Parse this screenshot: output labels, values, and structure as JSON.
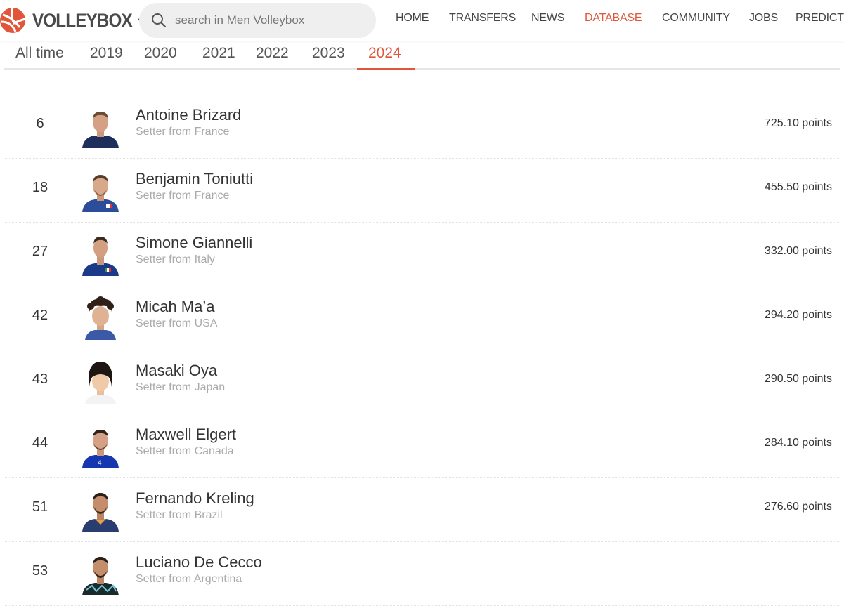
{
  "header": {
    "logo_text": "VOLLEYBOX",
    "search_placeholder": "search in Men Volleybox",
    "nav": [
      {
        "label": "HOME"
      },
      {
        "label": "TRANSFERS"
      },
      {
        "label": "NEWS"
      },
      {
        "label": "DATABASE",
        "active": true
      },
      {
        "label": "COMMUNITY"
      },
      {
        "label": "JOBS"
      },
      {
        "label": "PREDICTIC"
      }
    ]
  },
  "tabs": [
    {
      "label": "All time"
    },
    {
      "label": "2019"
    },
    {
      "label": "2020"
    },
    {
      "label": "2021"
    },
    {
      "label": "2022"
    },
    {
      "label": "2023"
    },
    {
      "label": "2024",
      "active": true
    }
  ],
  "players": [
    {
      "rank": "6",
      "name": "Antoine Brizard",
      "desc": "Setter from France",
      "points": "725.10 points"
    },
    {
      "rank": "18",
      "name": "Benjamin Toniutti",
      "desc": "Setter from France",
      "points": "455.50 points"
    },
    {
      "rank": "27",
      "name": "Simone Giannelli",
      "desc": "Setter from Italy",
      "points": "332.00 points"
    },
    {
      "rank": "42",
      "name": "Micah Ma’a",
      "desc": "Setter from USA",
      "points": "294.20 points"
    },
    {
      "rank": "43",
      "name": "Masaki Oya",
      "desc": "Setter from Japan",
      "points": "290.50 points"
    },
    {
      "rank": "44",
      "name": "Maxwell Elgert",
      "desc": "Setter from Canada",
      "points": "284.10 points"
    },
    {
      "rank": "51",
      "name": "Fernando Kreling",
      "desc": "Setter from Brazil",
      "points": "276.60 points"
    },
    {
      "rank": "53",
      "name": "Luciano De Cecco",
      "desc": "Setter from Argentina",
      "points": ""
    }
  ],
  "colors": {
    "accent": "#e1553a",
    "text": "#333333",
    "muted": "#aaaaaa",
    "search_bg": "#efefef"
  }
}
